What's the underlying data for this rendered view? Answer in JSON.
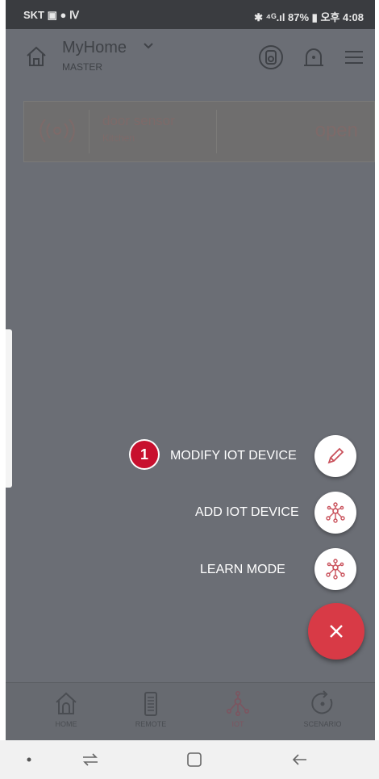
{
  "status_bar": {
    "left": "SKT ▣ ● Ⅳ",
    "right": "✱ ⁴ᴳ.ıl 87% ▮ 오후 4:08",
    "battery": "87%",
    "time": "오후 4:08"
  },
  "header": {
    "title": "MyHome",
    "subtitle": "MASTER"
  },
  "device_card": {
    "name": "door sensor",
    "room": "Kitchen",
    "state": "open"
  },
  "fab_menu": {
    "items": [
      {
        "label": "MODIFY IOT DEVICE",
        "icon": "pencil-icon"
      },
      {
        "label": "ADD IOT DEVICE",
        "icon": "iot-network-icon"
      },
      {
        "label": "LEARN MODE",
        "icon": "iot-network-icon"
      }
    ],
    "step_badge": "1",
    "close_icon": "close-icon"
  },
  "bottom_nav": {
    "items": [
      {
        "label": "HOME",
        "icon": "home-icon"
      },
      {
        "label": "REMOTE",
        "icon": "remote-icon"
      },
      {
        "label": "IOT",
        "icon": "iot-network-icon",
        "active": true
      },
      {
        "label": "SCENARIO",
        "icon": "scenario-icon"
      }
    ]
  },
  "colors": {
    "accent": "#d83a46",
    "overlay": "#6b6e75",
    "badge": "#c8102e"
  }
}
